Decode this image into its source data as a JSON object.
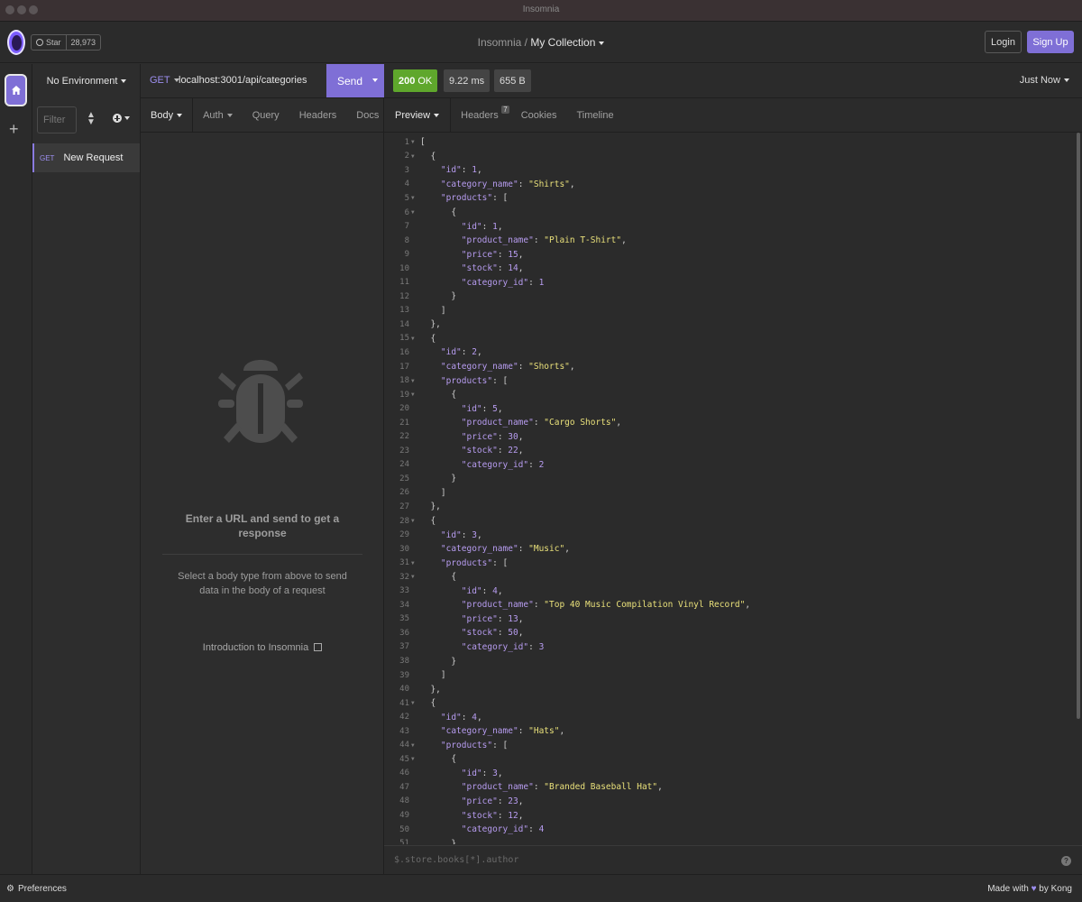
{
  "window": {
    "title": "Insomnia"
  },
  "header": {
    "github_star_label": "Star",
    "github_star_count": "28,973",
    "breadcrumb_root": "Insomnia",
    "breadcrumb_sep": "/",
    "breadcrumb_current": "My Collection",
    "login_label": "Login",
    "signup_label": "Sign Up"
  },
  "sidebar": {
    "environment": "No Environment",
    "filter_placeholder": "Filter",
    "requests": [
      {
        "method": "GET",
        "name": "New Request"
      }
    ]
  },
  "request": {
    "method": "GET",
    "url": "localhost:3001/api/categories",
    "send_label": "Send",
    "tabs": [
      "Body",
      "Auth",
      "Query",
      "Headers",
      "Docs"
    ],
    "empty_title": "Enter a URL and send to get a response",
    "empty_subtitle": "Select a body type from above to send data in the body of a request",
    "intro_link": "Introduction to Insomnia"
  },
  "response": {
    "status_code": "200",
    "status_text": "OK",
    "time": "9.22 ms",
    "size": "655 B",
    "timestamp": "Just Now",
    "tabs": [
      "Preview",
      "Headers",
      "Cookies",
      "Timeline"
    ],
    "headers_count": "7",
    "filter_placeholder": "$.store.books[*].author",
    "body_lines": [
      "[",
      "  {",
      "    \"id\": 1,",
      "    \"category_name\": \"Shirts\",",
      "    \"products\": [",
      "      {",
      "        \"id\": 1,",
      "        \"product_name\": \"Plain T-Shirt\",",
      "        \"price\": 15,",
      "        \"stock\": 14,",
      "        \"category_id\": 1",
      "      }",
      "    ]",
      "  },",
      "  {",
      "    \"id\": 2,",
      "    \"category_name\": \"Shorts\",",
      "    \"products\": [",
      "      {",
      "        \"id\": 5,",
      "        \"product_name\": \"Cargo Shorts\",",
      "        \"price\": 30,",
      "        \"stock\": 22,",
      "        \"category_id\": 2",
      "      }",
      "    ]",
      "  },",
      "  {",
      "    \"id\": 3,",
      "    \"category_name\": \"Music\",",
      "    \"products\": [",
      "      {",
      "        \"id\": 4,",
      "        \"product_name\": \"Top 40 Music Compilation Vinyl Record\",",
      "        \"price\": 13,",
      "        \"stock\": 50,",
      "        \"category_id\": 3",
      "      }",
      "    ]",
      "  },",
      "  {",
      "    \"id\": 4,",
      "    \"category_name\": \"Hats\",",
      "    \"products\": [",
      "      {",
      "        \"id\": 3,",
      "        \"product_name\": \"Branded Baseball Hat\",",
      "        \"price\": 23,",
      "        \"stock\": 12,",
      "        \"category_id\": 4",
      "      }"
    ],
    "fold_lines": [
      1,
      2,
      5,
      6,
      15,
      18,
      19,
      28,
      31,
      32,
      41,
      44,
      45
    ]
  },
  "footer": {
    "preferences_label": "Preferences",
    "made_with_prefix": "Made with",
    "made_with_suffix": "by Kong"
  },
  "colors": {
    "accent": "#7f6fd6",
    "status_ok": "#5fa72c",
    "json_key": "#b79cf0",
    "json_string": "#e9e07a"
  }
}
